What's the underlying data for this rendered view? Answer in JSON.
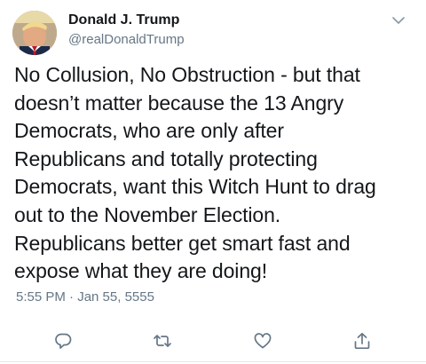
{
  "tweet": {
    "author": {
      "display_name": "Donald J. Trump",
      "handle": "@realDonaldTrump",
      "avatar": "profile-photo"
    },
    "text": "No Collusion, No Obstruction - but that doesn’t matter because the 13 Angry Democrats, who are only after Republicans and totally protecting Democrats, want this Witch Hunt to drag out to the November Election. Republicans better get smart fast and expose what they are doing!",
    "text_lines": [
      "No Collusion, No Obstruction - but that",
      "doesn’t matter because the 13 Angry",
      "Democrats, who are only after",
      "Republicans and totally protecting",
      "Democrats, want this Witch Hunt to drag",
      "out to the November Election.",
      "Republicans better get smart fast and",
      "expose what they are doing!"
    ],
    "timestamp": "5:55 PM · Jan 55, 5555"
  },
  "icons": {
    "menu": "chevron-down-icon",
    "reply": "reply-icon",
    "retweet": "retweet-icon",
    "like": "heart-icon",
    "share": "share-icon"
  },
  "colors": {
    "text_primary": "#14171a",
    "text_secondary": "#657786",
    "icon": "#657786"
  }
}
